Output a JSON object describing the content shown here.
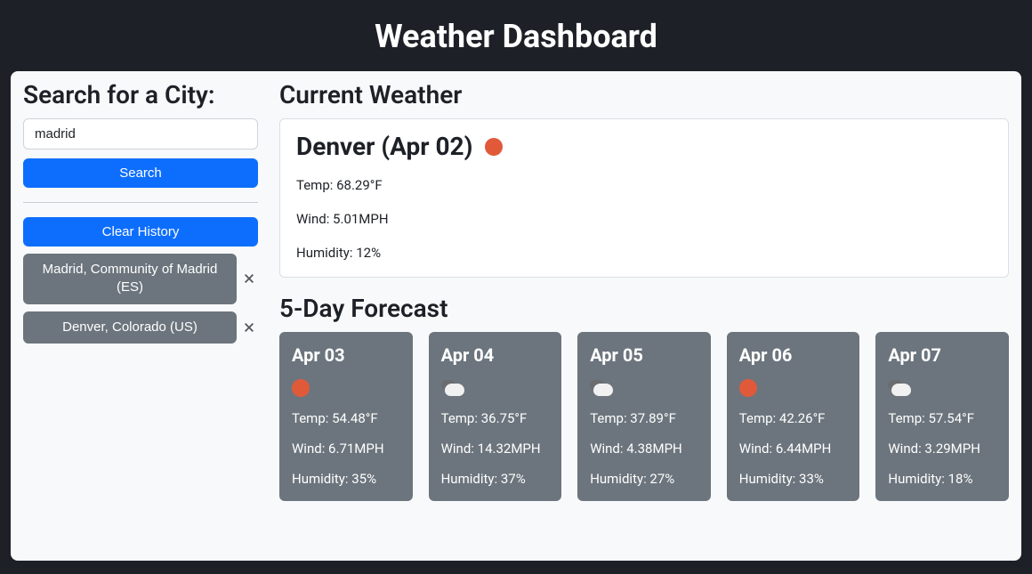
{
  "header": {
    "title": "Weather Dashboard"
  },
  "sidebar": {
    "heading": "Search for a City:",
    "search_value": "madrid",
    "search_button": "Search",
    "clear_button": "Clear History",
    "history": [
      {
        "label": "Madrid, Community of Madrid (ES)"
      },
      {
        "label": "Denver, Colorado (US)"
      }
    ]
  },
  "current": {
    "heading": "Current Weather",
    "city_date": "Denver (Apr 02)",
    "icon": "sun",
    "temp": "Temp: 68.29°F",
    "wind": "Wind: 5.01MPH",
    "humidity": "Humidity: 12%"
  },
  "forecast": {
    "heading": "5-Day Forecast",
    "days": [
      {
        "date": "Apr 03",
        "icon": "sun",
        "temp": "Temp: 54.48°F",
        "wind": "Wind: 6.71MPH",
        "humidity": "Humidity: 35%"
      },
      {
        "date": "Apr 04",
        "icon": "cloud",
        "temp": "Temp: 36.75°F",
        "wind": "Wind: 14.32MPH",
        "humidity": "Humidity: 37%"
      },
      {
        "date": "Apr 05",
        "icon": "cloud",
        "temp": "Temp: 37.89°F",
        "wind": "Wind: 4.38MPH",
        "humidity": "Humidity: 27%"
      },
      {
        "date": "Apr 06",
        "icon": "sun",
        "temp": "Temp: 42.26°F",
        "wind": "Wind: 6.44MPH",
        "humidity": "Humidity: 33%"
      },
      {
        "date": "Apr 07",
        "icon": "cloud",
        "temp": "Temp: 57.54°F",
        "wind": "Wind: 3.29MPH",
        "humidity": "Humidity: 18%"
      }
    ]
  }
}
